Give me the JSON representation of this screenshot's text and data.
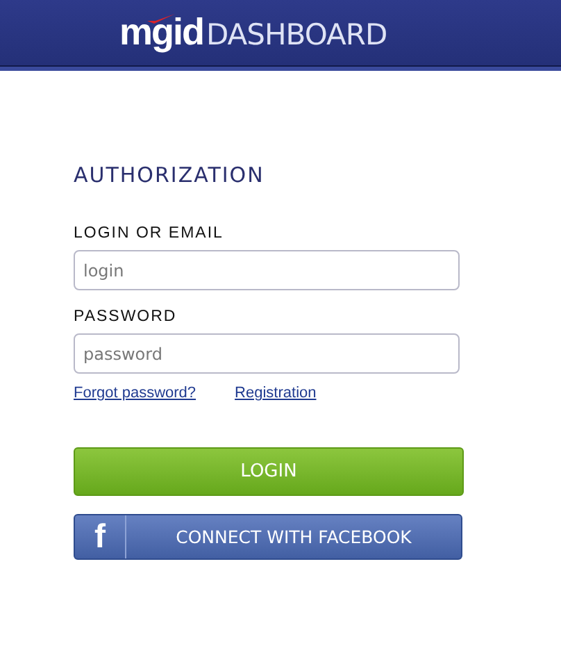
{
  "header": {
    "logo": "mgid",
    "title": "DASHBOARD"
  },
  "form": {
    "title": "AUTHORIZATION",
    "fields": [
      {
        "label": "LOGIN OR EMAIL",
        "placeholder": "login"
      },
      {
        "label": "PASSWORD",
        "placeholder": "password"
      }
    ],
    "links": [
      "Forgot password?",
      "Registration"
    ],
    "login_button": "LOGIN",
    "facebook_button": {
      "icon": "f",
      "label": "CONNECT WITH FACEBOOK"
    }
  }
}
